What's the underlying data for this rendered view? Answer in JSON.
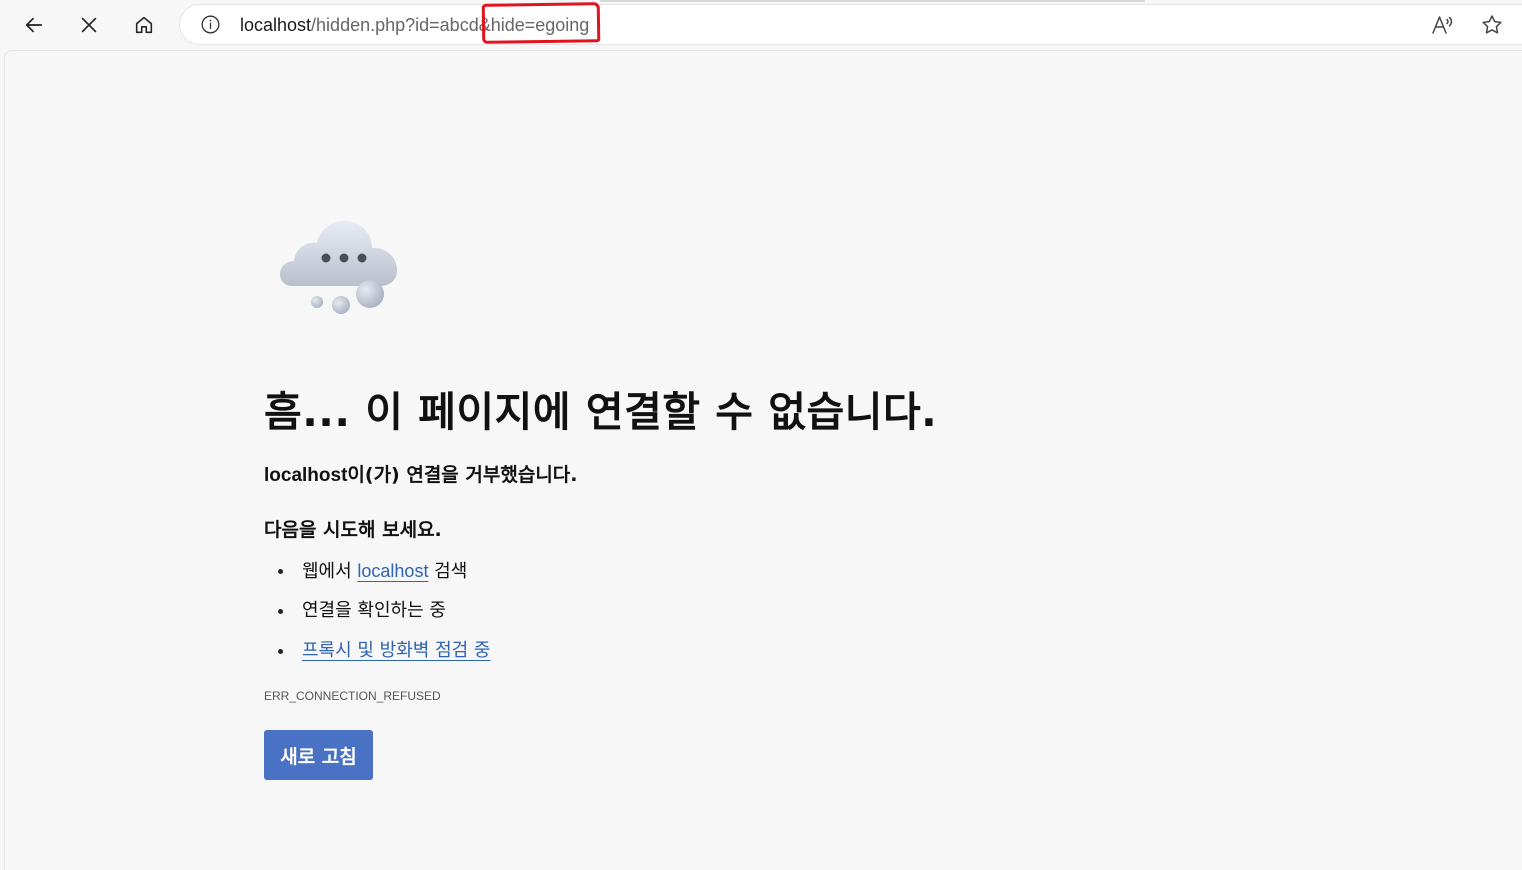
{
  "browser": {
    "url_host": "localhost",
    "url_rest": "/hidden.php?id=abcd&hide=egoing",
    "icons": [
      "back-arrow-icon",
      "close-icon",
      "home-icon",
      "info-icon",
      "read-aloud-icon",
      "star-icon"
    ]
  },
  "error_page": {
    "illustration": "cloud-icon",
    "heading": "흠... 이 페이지에 연결할 수 없습니다.",
    "subtitle_host": "localhost",
    "subtitle_rest": "이(가) 연결을 거부했습니다.",
    "try_heading": "다음을 시도해 보세요.",
    "suggestions": {
      "search_prefix": "웹에서 ",
      "search_link": "localhost",
      "search_suffix": " 검색",
      "check_connection": "연결을 확인하는 중",
      "proxy_link": "프록시 및 방화벽 점검 중"
    },
    "error_code": "ERR_CONNECTION_REFUSED",
    "refresh_label": "새로 고침"
  },
  "colors": {
    "page_background": "#f7f7f7",
    "link": "#2e63b5",
    "button": "#4a72c4",
    "annotation": "#e0141e"
  }
}
